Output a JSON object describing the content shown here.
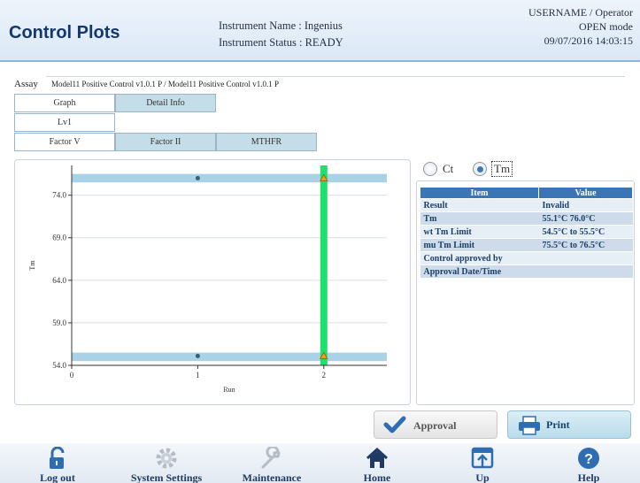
{
  "header": {
    "title": "Control Plots",
    "instrument_name": "Instrument Name : Ingenius",
    "instrument_status": "Instrument Status : READY",
    "user": "USERNAME / Operator",
    "mode": "OPEN mode",
    "datetime": "09/07/2016 14:03:15"
  },
  "assay": {
    "label": "Assay",
    "value": "Model11 Positive Control v1.0.1 P / Model11 Positive Control v1.0.1 P"
  },
  "tabs": {
    "graph": "Graph",
    "detail": "Detail Info",
    "level": "Lv1",
    "factor_v": "Factor V",
    "factor_ii": "Factor II",
    "mthfr": "MTHFR"
  },
  "radio": {
    "ct": "Ct",
    "tm": "Tm",
    "selected": "Tm"
  },
  "info_table": {
    "headers": [
      "Item",
      "Value"
    ],
    "rows": [
      [
        "Result",
        "Invalid"
      ],
      [
        "Tm",
        "55.1°C  76.0°C"
      ],
      [
        "wt Tm Limit",
        "54.5°C to 55.5°C"
      ],
      [
        "mu Tm Limit",
        "75.5°C to 76.5°C"
      ],
      [
        "Control approved by",
        ""
      ],
      [
        "Approval Date/Time",
        ""
      ]
    ]
  },
  "buttons": {
    "approval": "Approval",
    "print": "Print"
  },
  "nav": {
    "logout": "Log out",
    "system_settings": "System Settings",
    "maintenance": "Maintenance",
    "home": "Home",
    "up": "Up",
    "help": "Help"
  },
  "colors": {
    "limit_band": "#a9d2e6",
    "highlight_run": "#1fe06c",
    "point_normal": "#3a5f7a",
    "point_flagged": "#e8a317"
  },
  "chart_data": {
    "type": "scatter",
    "xlabel": "Run",
    "ylabel": "Tm",
    "xlim": [
      0,
      2.5
    ],
    "ylim": [
      54.0,
      77.5
    ],
    "x_ticks": [
      "0",
      "1",
      "2"
    ],
    "y_ticks": [
      "54.0",
      "59.0",
      "64.0",
      "69.0",
      "74.0"
    ],
    "limit_bands": [
      {
        "name": "wt",
        "range": [
          54.5,
          55.5
        ]
      },
      {
        "name": "mu",
        "range": [
          75.5,
          76.5
        ]
      }
    ],
    "highlight_x": 2,
    "points": [
      {
        "x": 1,
        "y": 55.1,
        "flagged": false
      },
      {
        "x": 1,
        "y": 76.0,
        "flagged": false
      },
      {
        "x": 2,
        "y": 55.1,
        "flagged": true
      },
      {
        "x": 2,
        "y": 76.0,
        "flagged": true
      }
    ],
    "grid": true
  }
}
